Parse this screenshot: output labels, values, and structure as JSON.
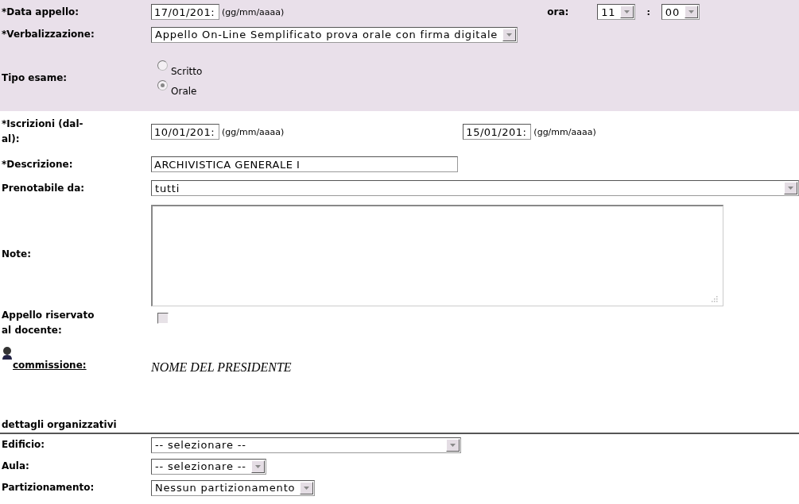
{
  "data_appello": {
    "label": "*Data appello:",
    "value": "17/01/201:",
    "hint": "(gg/mm/aaaa)",
    "time_label": "ora:",
    "hour": "11",
    "separator": ":",
    "minute": "00"
  },
  "verbalizzazione": {
    "label": "*Verbalizzazione:",
    "value": "Appello On-Line Semplificato prova orale con firma digitale"
  },
  "tipo_esame": {
    "label": "Tipo esame:",
    "options": [
      {
        "label": "Scritto",
        "selected": false
      },
      {
        "label": "Orale",
        "selected": true
      }
    ]
  },
  "iscrizioni": {
    "label": "*Iscrizioni (dal-al):",
    "from": "10/01/201:",
    "from_hint": "(gg/mm/aaaa)",
    "to": "15/01/201:",
    "to_hint": "(gg/mm/aaaa)"
  },
  "descrizione": {
    "label": "*Descrizione:",
    "value": "ARCHIVISTICA GENERALE I"
  },
  "prenotabile": {
    "label": "Prenotabile da:",
    "value": "tutti"
  },
  "note": {
    "label": "Note:"
  },
  "riservato": {
    "label": "Appello riservato al docente:",
    "checked": false
  },
  "commissione": {
    "label": "commissione:",
    "president": "NOME DEL PRESIDENTE"
  },
  "dettagli": {
    "title": "dettagli organizzativi",
    "fields": [
      {
        "label": "Edificio:",
        "value": "-- selezionare --"
      },
      {
        "label": "Aula:",
        "value": "-- selezionare --"
      },
      {
        "label": "Partizionamento:",
        "value": "Nessun partizionamento"
      }
    ]
  }
}
